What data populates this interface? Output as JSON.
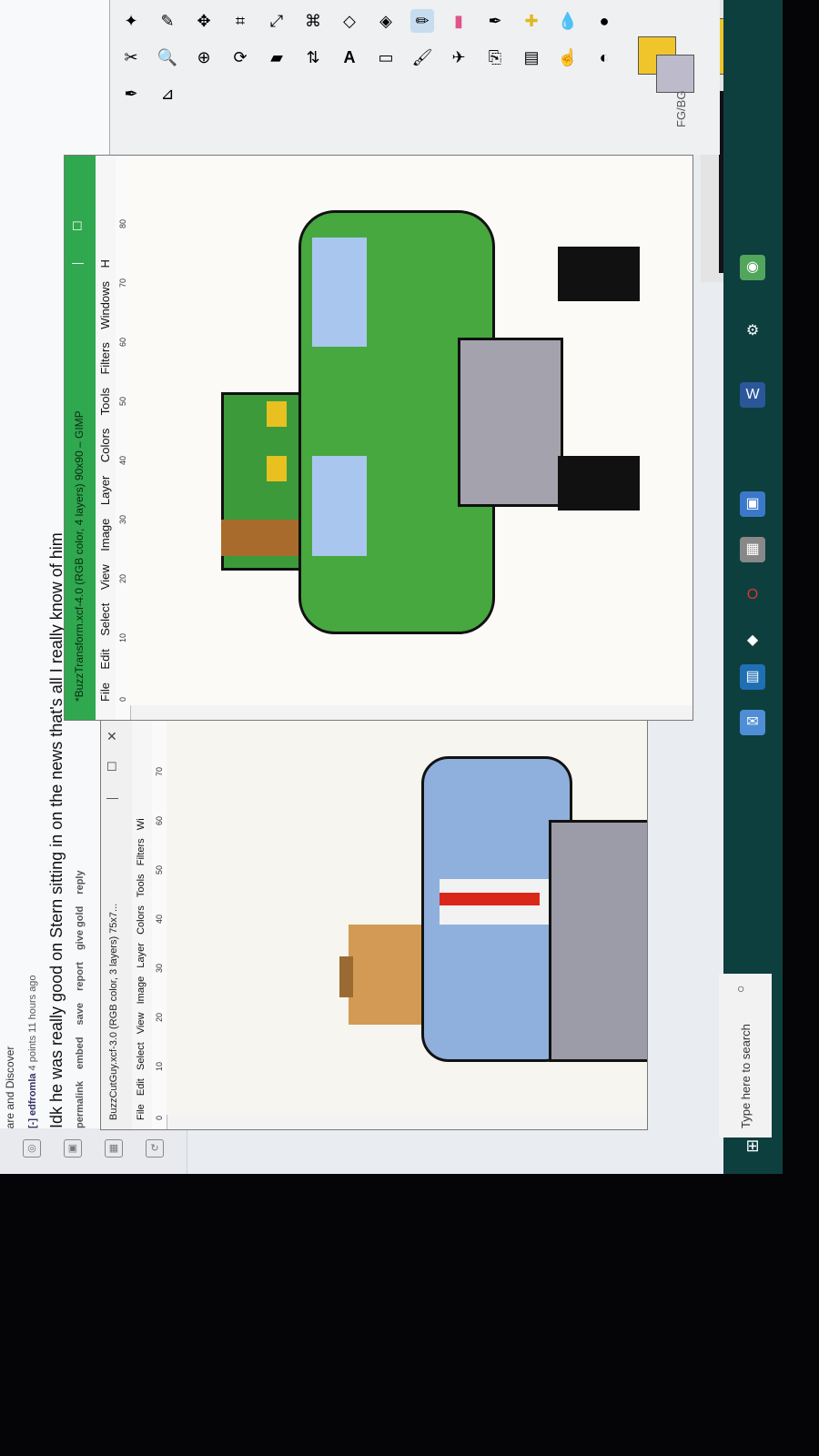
{
  "reddit": {
    "share_text": "Share and Discover",
    "meta_user": "[-] edfromla",
    "meta_points": "4 points 11 hours ago",
    "comment": "Idk he was really good on Stern sitting in on the news that's all I really know of him",
    "links": [
      "permalink",
      "embed",
      "save",
      "report",
      "give gold",
      "reply"
    ]
  },
  "gimp_left": {
    "title": "BuzzCutGuy.xcf-3.0 (RGB color, 3 layers) 75x7...",
    "menus": [
      "File",
      "Edit",
      "Select",
      "View",
      "Image",
      "Layer",
      "Colors",
      "Tools",
      "Filters",
      "Wi"
    ],
    "ruler_ticks": [
      "0",
      "10",
      "20",
      "30",
      "40",
      "50",
      "60",
      "70"
    ]
  },
  "gimp_right": {
    "title": "*BuzzTransform.xcf-4.0 (RGB color, 4 layers) 90x90 – GIMP",
    "menus": [
      "File",
      "Edit",
      "Select",
      "View",
      "Image",
      "Layer",
      "Colors",
      "Tools",
      "Filters",
      "Windows",
      "H"
    ],
    "ruler_ticks": [
      "0",
      "10",
      "20",
      "30",
      "40",
      "50",
      "60",
      "70",
      "80"
    ]
  },
  "toolbox": {
    "fg_bg_label": "FG/BG",
    "fg_bg_label2": "FG/BG"
  },
  "taskbar": {
    "search_placeholder": "Type here to search"
  },
  "colors": {
    "taskbar": "#0d3f3f",
    "gimp_title": "#2fa84f",
    "canvas": "#f7f5ef"
  }
}
